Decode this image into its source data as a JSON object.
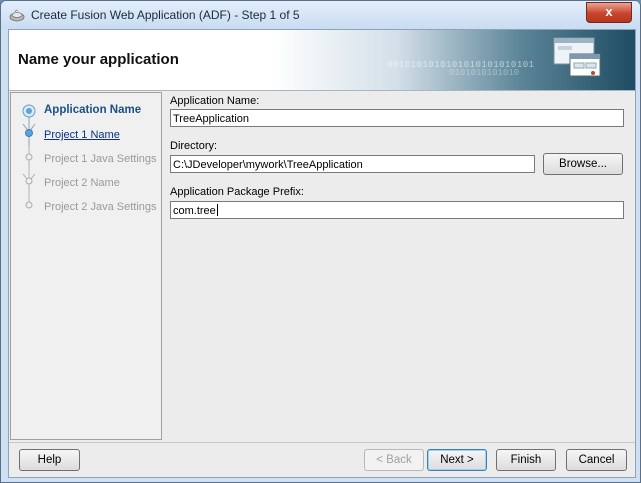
{
  "window": {
    "title": "Create Fusion Web Application (ADF) - Step 1 of 5",
    "close_label": "x"
  },
  "header": {
    "title": "Name your application",
    "binary_text": "0010101010101010101010101",
    "binary_text2": "0101010101010"
  },
  "steps": [
    {
      "label": "Application Name",
      "state": "active"
    },
    {
      "label": "Project 1 Name",
      "state": "visited"
    },
    {
      "label": "Project 1 Java Settings",
      "state": "future"
    },
    {
      "label": "Project 2 Name",
      "state": "future"
    },
    {
      "label": "Project 2 Java Settings",
      "state": "future"
    }
  ],
  "form": {
    "app_name_label": "Application Name:",
    "app_name_value": "TreeApplication",
    "directory_label": "Directory:",
    "directory_value": "C:\\JDeveloper\\mywork\\TreeApplication",
    "browse_label": "Browse...",
    "prefix_label": "Application Package Prefix:",
    "prefix_value": "com.tree"
  },
  "buttons": {
    "help": "Help",
    "back": "< Back",
    "next": "Next >",
    "finish": "Finish",
    "cancel": "Cancel"
  },
  "colors": {
    "active_step": "#1c4f88",
    "visited_step": "#0b2f8a",
    "future_step": "#9a9a9a",
    "close_button": "#c8452b"
  }
}
